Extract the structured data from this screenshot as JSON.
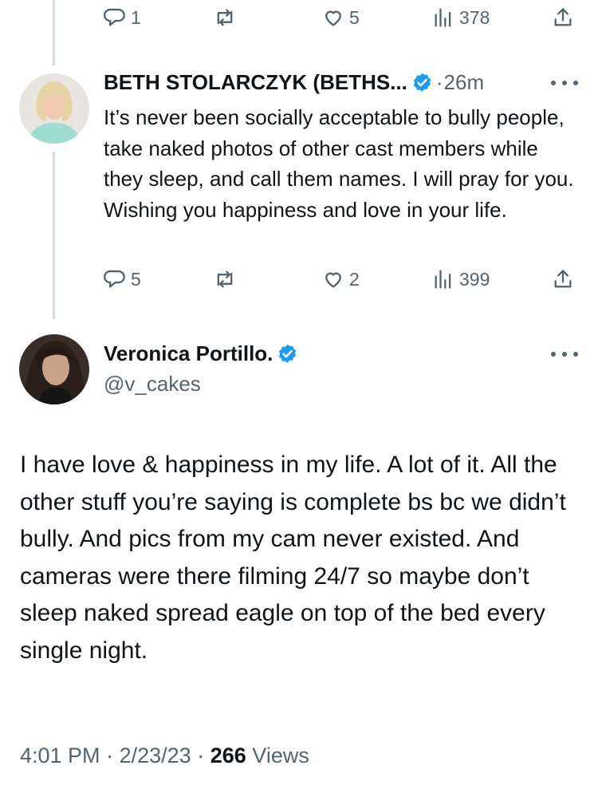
{
  "previous_tweet": {
    "actions": {
      "replies": "1",
      "retweets": "",
      "likes": "5",
      "views": "378"
    }
  },
  "reply_tweet": {
    "display_name": "BETH STOLARCZYK (BETHS...",
    "separator": "·",
    "time_ago": "26m",
    "text": "It’s never been socially acceptable to bully people, take naked photos of other cast members while they sleep, and call them names. I will pray for you. Wishing you happiness and love in your life.",
    "actions": {
      "replies": "5",
      "retweets": "",
      "likes": "2",
      "views": "399"
    }
  },
  "main_tweet": {
    "display_name": "Veronica Portillo.",
    "handle": "@v_cakes",
    "text": "I have love & happiness in my life.  A lot of it.  All the other stuff you’re saying is complete bs bc we didn’t bully.  And pics from my cam never existed.  And cameras were there filming 24/7 so maybe don’t sleep naked spread eagle on top of the bed every single night.",
    "time": "4:01 PM",
    "date": "2/23/23",
    "separator": "·",
    "views_count": "266",
    "views_label": "Views"
  },
  "colors": {
    "verified_blue": "#1d9bf0",
    "secondary_text": "#536471",
    "thread_line": "#cfd9de"
  },
  "icons": [
    "reply-icon",
    "retweet-icon",
    "like-icon",
    "views-icon",
    "share-icon",
    "verified-badge-icon",
    "more-options-icon"
  ]
}
